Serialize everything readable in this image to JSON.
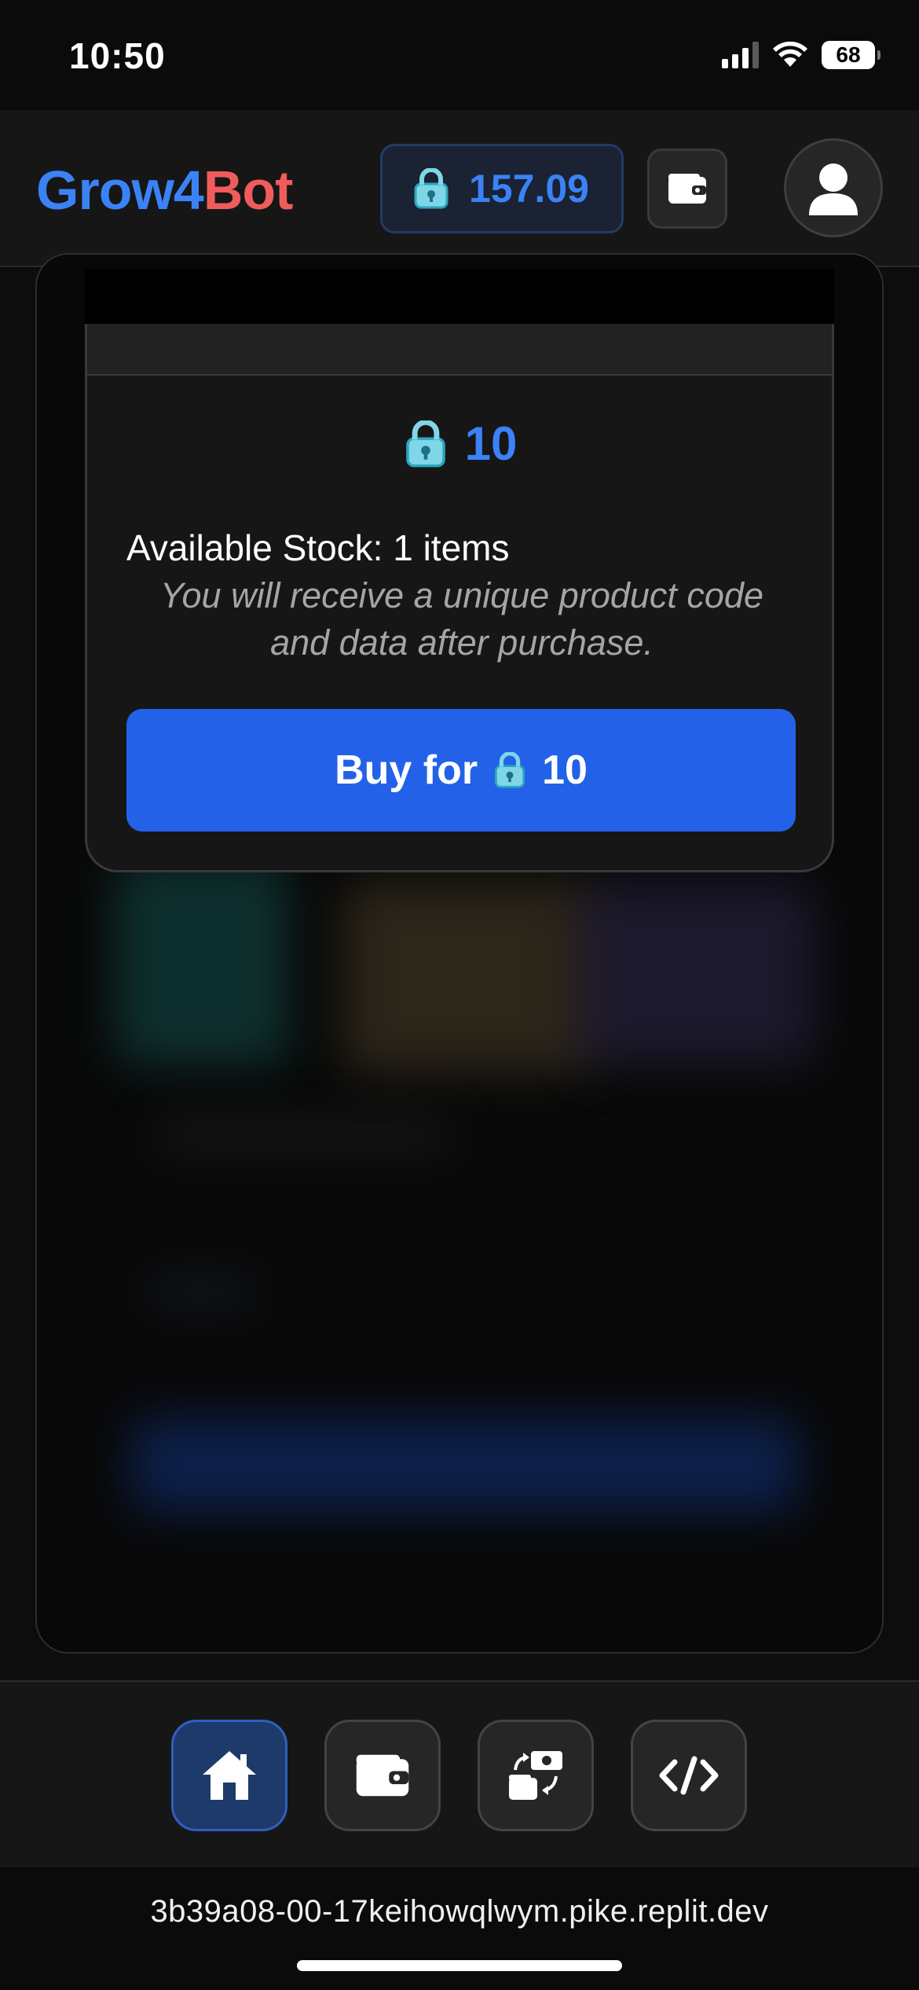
{
  "status_bar": {
    "time": "10:50",
    "battery": "68"
  },
  "header": {
    "brand_part1": "Grow4",
    "brand_part2": "Bot",
    "balance": "157.09",
    "balance_icon": "lock-icon",
    "wallet_icon": "wallet-icon",
    "avatar_icon": "user-icon",
    "colors": {
      "brand_blue": "#3b82f6",
      "brand_red": "#f05c5c"
    }
  },
  "modal": {
    "price": "10",
    "price_icon": "lock-icon",
    "stock_label": "Available Stock: 1 items",
    "receive_note": "You will receive a unique product code and data after purchase.",
    "buy_prefix": "Buy for",
    "buy_amount": "10",
    "button_color": "#2362e8"
  },
  "bottom_nav": {
    "items": [
      {
        "icon": "home-icon",
        "active": true
      },
      {
        "icon": "wallet-icon",
        "active": false
      },
      {
        "icon": "exchange-icon",
        "active": false
      },
      {
        "icon": "code-icon",
        "active": false
      }
    ]
  },
  "browser": {
    "url": "3b39a08-00-17keihowqlwym.pike.replit.dev"
  }
}
